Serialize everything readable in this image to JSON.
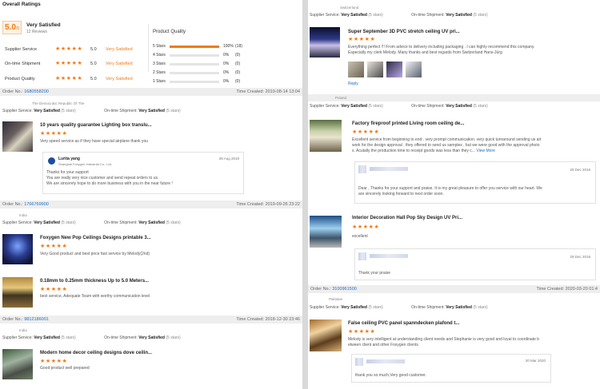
{
  "overall": {
    "heading": "Overall Ratings",
    "score": "5.0",
    "score_suffix": "/5",
    "verdict": "Very Satisfied",
    "reviews": "12 Reviews",
    "rows": [
      {
        "label": "Supplier Service",
        "score": "5.0",
        "text": "Very Satisfied"
      },
      {
        "label": "On-time Shipment",
        "score": "5.0",
        "text": "Very Satisfied"
      },
      {
        "label": "Product Quality",
        "score": "5.0",
        "text": "Very Satisfied"
      }
    ],
    "quality_heading": "Product Quality",
    "breakdown": [
      {
        "label": "5 Stars",
        "pct": "100%",
        "count": "(18)",
        "fill": 1.0
      },
      {
        "label": "4 Stars",
        "pct": "0%",
        "count": "(0)",
        "fill": 0
      },
      {
        "label": "3 Stars",
        "pct": "0%",
        "count": "(0)",
        "fill": 0
      },
      {
        "label": "2 Stars",
        "pct": "0%",
        "count": "(0)",
        "fill": 0
      },
      {
        "label": "1 Stars",
        "pct": "0%",
        "count": "(0)",
        "fill": 0
      }
    ]
  },
  "labels": {
    "order_no": "Order No.:",
    "time_created": "Time Created:",
    "supplier_service": "Supplier Service:",
    "ontime": "On-time Shipment:",
    "very_satisfied": "Very Satisfied",
    "five_stars": "(5 stars)",
    "reply": "Reply",
    "star_glyphs": "★★★★★"
  },
  "left_orders": [
    {
      "order_no": "1680558200",
      "time": "2019-08-14 13:04",
      "country": "The Democratic Republic Of The",
      "items": [
        {
          "title": "10 years quality guarantee Lighting box translu...",
          "text": "Very speed service as if they have special airplane thank you",
          "reply": {
            "name": "Lurita yang",
            "company": "Shanghai Foxygen Industrial Co., Ltd.",
            "date": "28 Aug 2019",
            "lines": [
              "Thanks for your support",
              "You are really very nice customer and send repeat orders to us.",
              "We are sincerely hope to do more business with you in the near future !"
            ]
          }
        }
      ]
    },
    {
      "order_no": "1766769900",
      "time": "2019-09-26 23:22",
      "country": "India",
      "items": [
        {
          "title": "Foxygen New Pop Ceilings Designs printable 3...",
          "text": "Very Good product and best price fast service by Melody(2nd)"
        },
        {
          "title": "0.18mm to 0.25mm thickness Up to 5.0 Meters...",
          "text": "best service, Adequate Team with worthy communication level"
        }
      ]
    },
    {
      "order_no": "9812186001",
      "time": "2018-12-30 23:46",
      "country": "India",
      "items": [
        {
          "title": "Modern home decor ceiling designs dove ceilin...",
          "text": "Good product well prepared"
        }
      ]
    }
  ],
  "right_top": {
    "country": "Switzerland",
    "title": "Super September 3D PVC stretch ceiling UV pri...",
    "text_lines": [
      "Everything perfect !!! From advice to delivery including packaging . I can highly recommend this company.",
      "Especially my clerk Melody. Many thanks and best regards from Switzerland Hans-Jürg"
    ]
  },
  "right_orders": [
    {
      "country": "Poland",
      "items": [
        {
          "title": "Factory fireproof printed Living room ceiling de...",
          "text_lines": [
            "Excellent service from beginning to end . very prompt communication. very quick turnaround sending us art",
            "work for the design approval . they offered to send us samples . but we were good with the approval photo",
            "s. Acutally the production time to receipt goods was less than they c..."
          ],
          "view_more": "View More",
          "reply_date": "29 Dec 2018",
          "reply_lines": [
            "Dear , Thanks for your support and praise. It is my great pleasure to offer you service with our heart. We",
            "are sincerely looking forward to next order soon."
          ]
        },
        {
          "title": "Interior Decoration Hall Pop Sky Design UV Pri...",
          "text_lines": [
            "excellent"
          ],
          "reply_date": "29 Dec 2018",
          "reply_lines": [
            "Thank your praise"
          ]
        }
      ]
    },
    {
      "order_no": "3100961500",
      "time": "2020-03-20 01:4",
      "country": "Pakistan",
      "items": [
        {
          "title": "False ceiling PVC panel spanndecken plafond t...",
          "text_lines": [
            "Melody is very intelligent at understanding client needs and Stephanie is very good and loyal to coordinate b",
            "etween client and other Foxygen clients"
          ],
          "reply_date": "20 Mar 2020",
          "reply_lines": [
            "thank you so much,Very good customer."
          ]
        }
      ]
    }
  ]
}
